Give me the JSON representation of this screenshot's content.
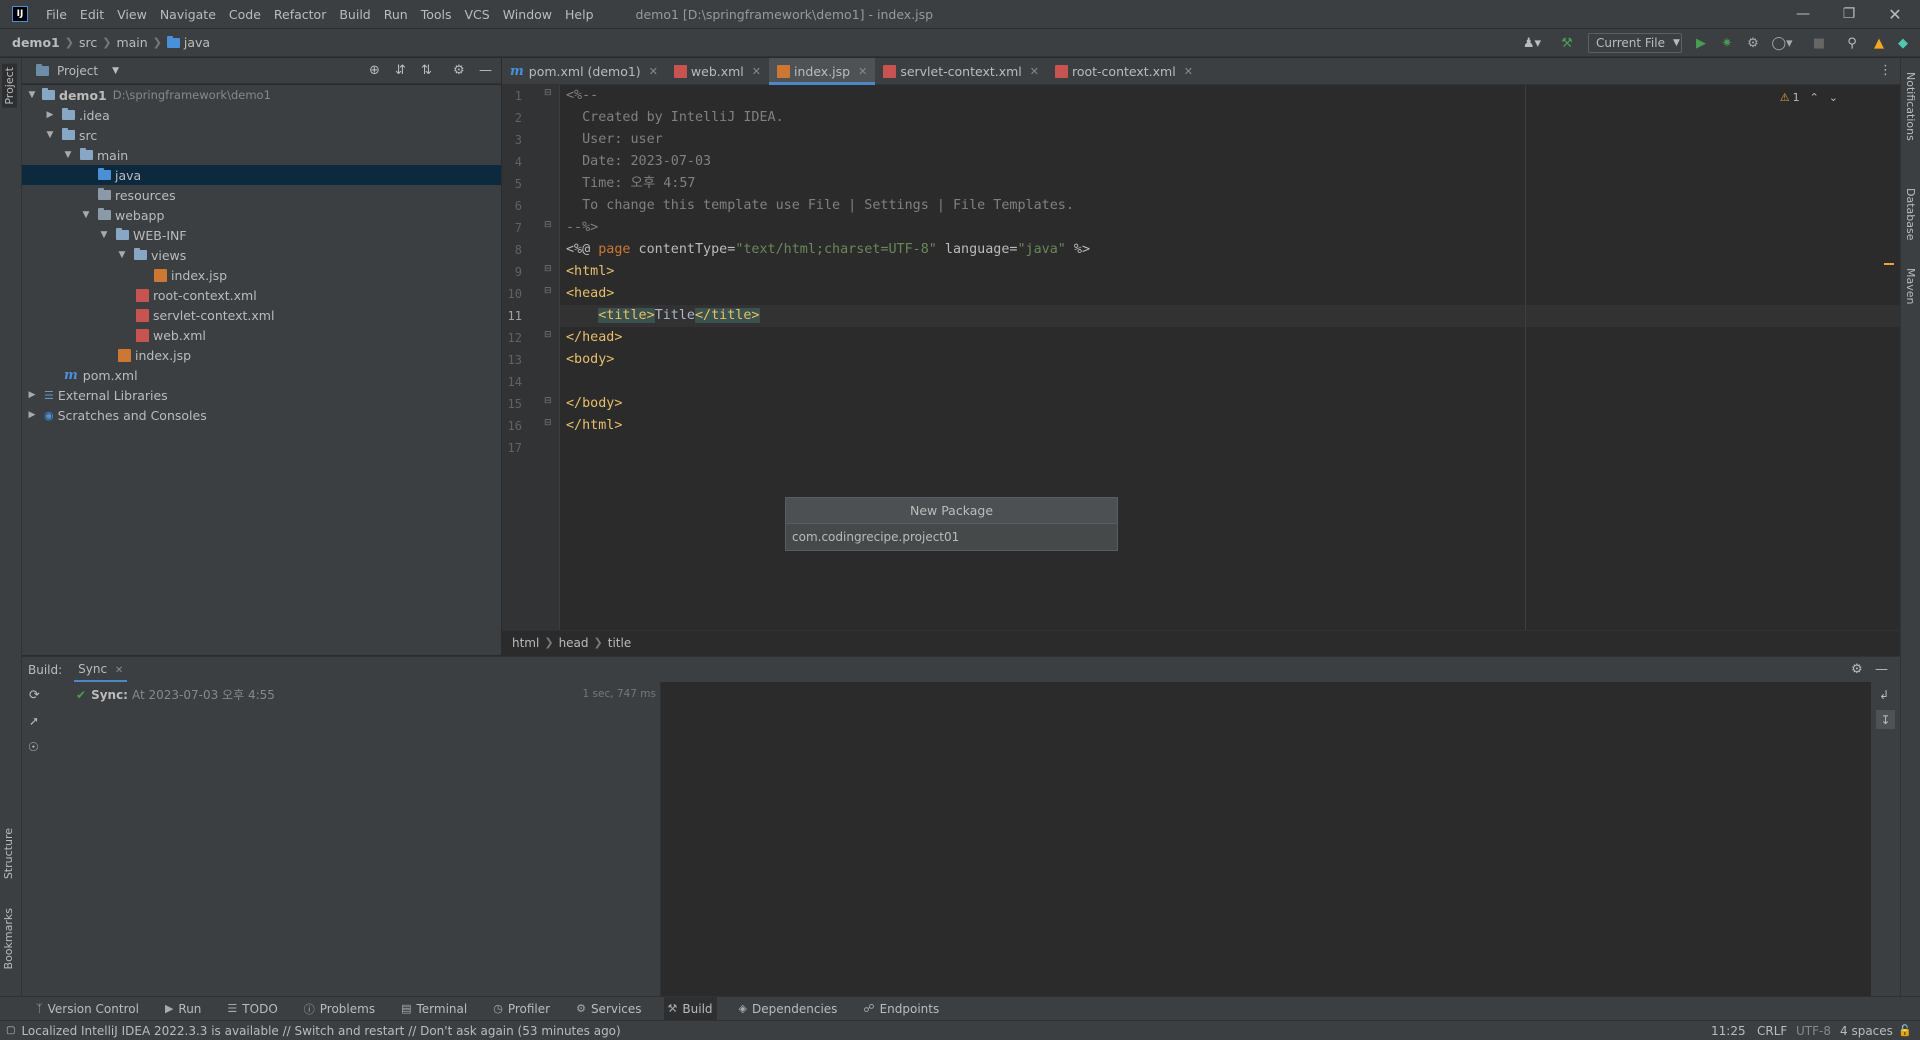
{
  "window": {
    "title": "demo1 [D:\\springframework\\demo1] - index.jsp",
    "app_icon_label": "IJ"
  },
  "menu": [
    "File",
    "Edit",
    "View",
    "Navigate",
    "Code",
    "Refactor",
    "Build",
    "Run",
    "Tools",
    "VCS",
    "Window",
    "Help"
  ],
  "navbar": {
    "crumbs": [
      "demo1",
      "src",
      "main",
      "java"
    ],
    "run_config": "Current File"
  },
  "left_stripe": {
    "project": "Project",
    "structure": "Structure",
    "bookmarks": "Bookmarks"
  },
  "right_stripe": {
    "notifications": "Notifications",
    "database": "Database",
    "maven": "Maven"
  },
  "project_panel": {
    "title": "Project",
    "tree": [
      {
        "label": "demo1",
        "path": "D:\\springframework\\demo1"
      },
      {
        "label": ".idea"
      },
      {
        "label": "src"
      },
      {
        "label": "main"
      },
      {
        "label": "java"
      },
      {
        "label": "resources"
      },
      {
        "label": "webapp"
      },
      {
        "label": "WEB-INF"
      },
      {
        "label": "views"
      },
      {
        "label": "index.jsp"
      },
      {
        "label": "root-context.xml"
      },
      {
        "label": "servlet-context.xml"
      },
      {
        "label": "web.xml"
      },
      {
        "label": "index.jsp"
      },
      {
        "label": "pom.xml"
      },
      {
        "label": "External Libraries"
      },
      {
        "label": "Scratches and Consoles"
      }
    ]
  },
  "editor": {
    "tabs": [
      {
        "label": "pom.xml (demo1)"
      },
      {
        "label": "web.xml"
      },
      {
        "label": "index.jsp"
      },
      {
        "label": "servlet-context.xml"
      },
      {
        "label": "root-context.xml"
      }
    ],
    "active_tab": "index.jsp",
    "current_line": 11,
    "line_numbers": [
      "1",
      "2",
      "3",
      "4",
      "5",
      "6",
      "7",
      "8",
      "9",
      "10",
      "11",
      "12",
      "13",
      "14",
      "15",
      "16",
      "17"
    ],
    "lines": [
      "<%--",
      "  Created by IntelliJ IDEA.",
      "  User: user",
      "  Date: 2023-07-03",
      "  Time: 오후 4:57",
      "  To change this template use File | Settings | File Templates.",
      "--%>",
      "<%@ page contentType=\"text/html;charset=UTF-8\" language=\"java\" %>",
      "<html>",
      "<head>",
      "    <title>Title</title>",
      "</head>",
      "<body>",
      "",
      "</body>",
      "</html>",
      ""
    ],
    "line8_parts": {
      "open": "<%@ ",
      "page": "page",
      "attr1": " contentType=",
      "val1": "\"text/html;charset=UTF-8\"",
      "attr2": " language=",
      "val2": "\"java\"",
      "close": " %>"
    },
    "line11_parts": {
      "indent": "    ",
      "open": "<title>",
      "text": "Title",
      "close": "</title>"
    },
    "warnings_count": "1",
    "breadcrumb": [
      "html",
      "head",
      "title"
    ]
  },
  "popup": {
    "title": "New Package",
    "value": "com.codingrecipe.project01"
  },
  "build_panel": {
    "label": "Build:",
    "tab": "Sync",
    "sync_label": "Sync:",
    "sync_detail": "At 2023-07-03 오후 4:55",
    "duration": "1 sec, 747 ms"
  },
  "bottom_tools": [
    {
      "label": "Version Control",
      "icon": "branch-icon"
    },
    {
      "label": "Run",
      "icon": "play-icon"
    },
    {
      "label": "TODO",
      "icon": "list-icon"
    },
    {
      "label": "Problems",
      "icon": "warning-icon"
    },
    {
      "label": "Terminal",
      "icon": "terminal-icon"
    },
    {
      "label": "Profiler",
      "icon": "profiler-icon"
    },
    {
      "label": "Services",
      "icon": "services-icon"
    },
    {
      "label": "Build",
      "icon": "hammer-icon"
    },
    {
      "label": "Dependencies",
      "icon": "dependencies-icon"
    },
    {
      "label": "Endpoints",
      "icon": "endpoints-icon"
    }
  ],
  "status": {
    "message": "Localized IntelliJ IDEA 2022.3.3 is available // Switch and restart // Don't ask again (53 minutes ago)",
    "caret": "11:25",
    "line_sep": "CRLF",
    "encoding": "UTF-8",
    "indent": "4 spaces"
  },
  "colors": {
    "accent": "#4a88c7",
    "background": "#2b2b2b",
    "panel": "#3c3f41",
    "selection": "#0d293e",
    "run_green": "#499c54",
    "warning": "#e8a33d"
  }
}
